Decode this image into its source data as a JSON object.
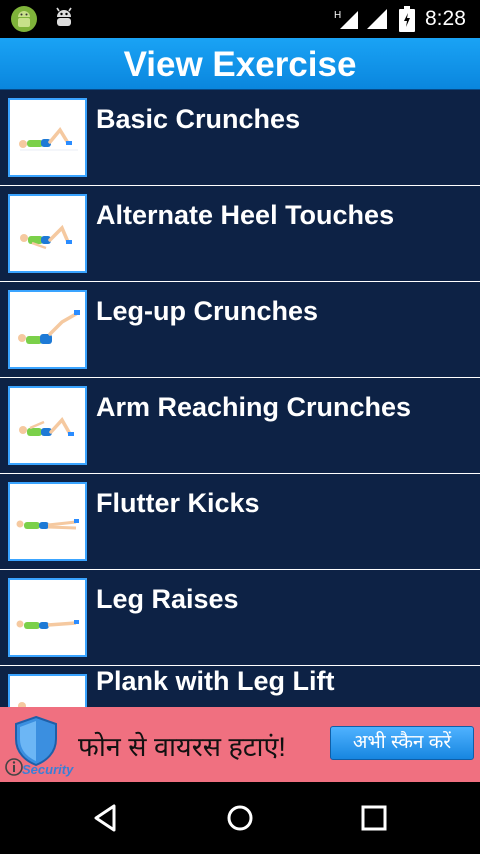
{
  "status_bar": {
    "time": "8:28",
    "network_label": "H",
    "icons": [
      "android-icon",
      "bug-icon",
      "signal-icon",
      "battery-icon"
    ]
  },
  "header": {
    "title": "View Exercise",
    "color": "#1199ee"
  },
  "exercises": [
    {
      "label": "Basic Crunches"
    },
    {
      "label": "Alternate Heel Touches"
    },
    {
      "label": "Leg-up Crunches"
    },
    {
      "label": "Arm Reaching Crunches"
    },
    {
      "label": "Flutter Kicks"
    },
    {
      "label": "Leg Raises"
    },
    {
      "label": "Plank with Leg Lift"
    }
  ],
  "ad": {
    "message": "फोन से वायरस हटाएं!",
    "button_label": "अभी स्कैन करें",
    "brand": "Security",
    "background": "#f07080"
  },
  "nav_bar": {
    "buttons": [
      "back-icon",
      "home-icon",
      "recents-icon"
    ]
  }
}
